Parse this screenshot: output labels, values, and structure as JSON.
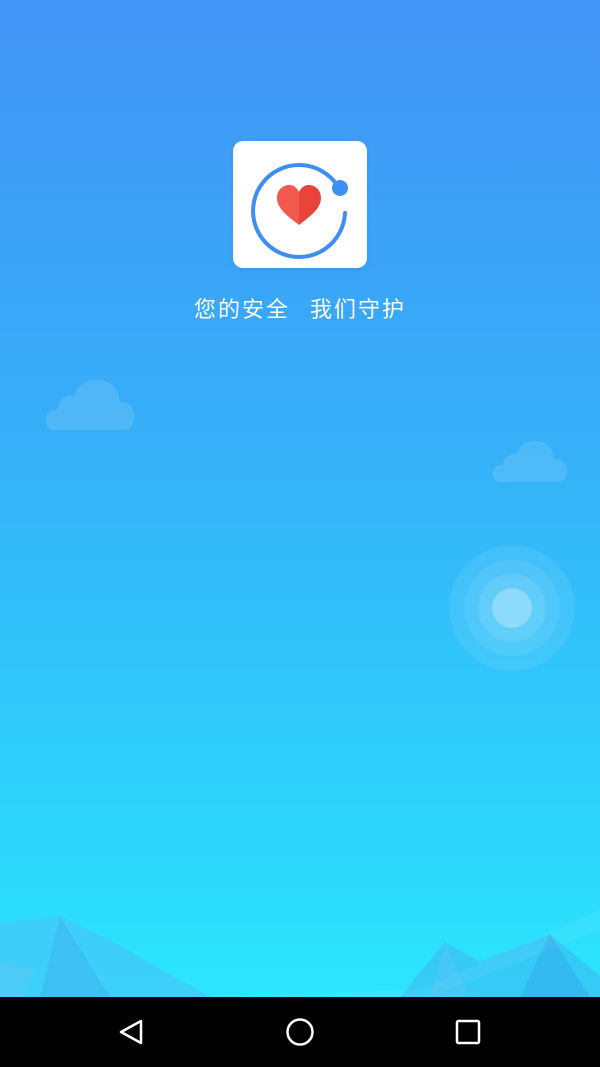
{
  "splash": {
    "slogan_part1": "您的安全",
    "slogan_part2": "我们守护",
    "logo_icon": "heart-orbit-icon",
    "colors": {
      "gradient_top": "#4394f7",
      "gradient_bottom": "#2ce6fd",
      "heart_left": "#f25a4e",
      "heart_right": "#e8443a",
      "orbit": "#3d8ef5",
      "card": "#ffffff"
    }
  },
  "navbar": {
    "back_icon": "back-triangle-icon",
    "home_icon": "home-circle-icon",
    "recent_icon": "recent-apps-square-icon"
  }
}
